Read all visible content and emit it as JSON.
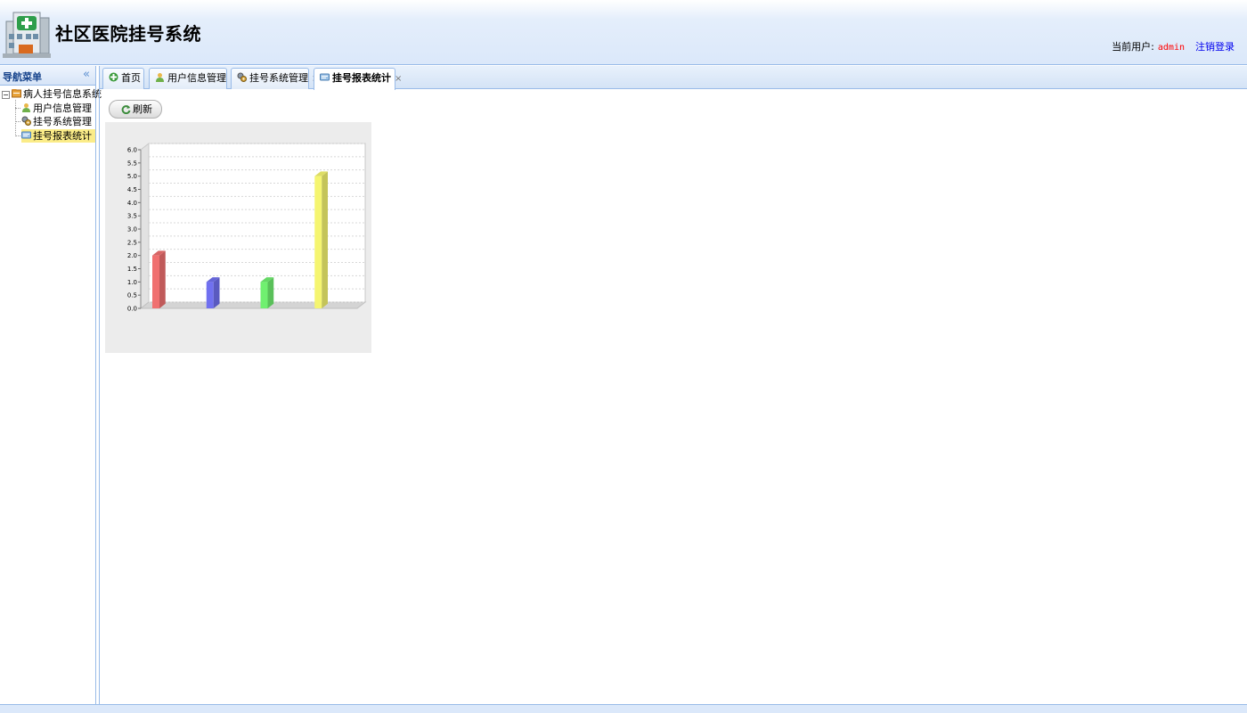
{
  "app": {
    "title": "社区医院挂号系统",
    "current_user_label": "当前用户:",
    "current_user": "admin",
    "logout_label": "注销登录"
  },
  "nav": {
    "title": "导航菜单",
    "collapse_icon": "double-chevron-left-icon",
    "root": {
      "label": "病人挂号信息系统",
      "icon": "folder-icon",
      "expanded": true
    },
    "items": [
      {
        "label": "用户信息管理",
        "icon": "user-icon",
        "selected": false
      },
      {
        "label": "挂号系统管理",
        "icon": "gear-icon",
        "selected": false
      },
      {
        "label": "挂号报表统计",
        "icon": "report-icon",
        "selected": true
      }
    ]
  },
  "tabs": [
    {
      "label": "首页",
      "icon": "home-icon",
      "closable": false,
      "active": false
    },
    {
      "label": "用户信息管理",
      "icon": "user-icon",
      "closable": true,
      "active": false
    },
    {
      "label": "挂号系统管理",
      "icon": "gear-icon",
      "closable": true,
      "active": false
    },
    {
      "label": "挂号报表统计",
      "icon": "report-icon",
      "closable": true,
      "active": true
    }
  ],
  "toolbar": {
    "refresh_label": "刷新",
    "refresh_icon": "refresh-icon"
  },
  "colors": {
    "accent": "#99bbe8",
    "selected_bg": "#fbec88",
    "chart_bg": "#ececec"
  },
  "chart_data": {
    "type": "bar",
    "style": "3d",
    "categories": [
      "",
      "",
      "",
      ""
    ],
    "values": [
      2,
      1,
      1,
      5
    ],
    "colors": [
      "#f07070",
      "#7070f0",
      "#70f070",
      "#f5f570"
    ],
    "ylim": [
      0,
      6.0
    ],
    "yticks": [
      "0.0",
      "0.5",
      "1.0",
      "1.5",
      "2.0",
      "2.5",
      "3.0",
      "3.5",
      "4.0",
      "4.5",
      "5.0",
      "5.5",
      "6.0"
    ],
    "grid": true,
    "title": "",
    "xlabel": "",
    "ylabel": ""
  }
}
